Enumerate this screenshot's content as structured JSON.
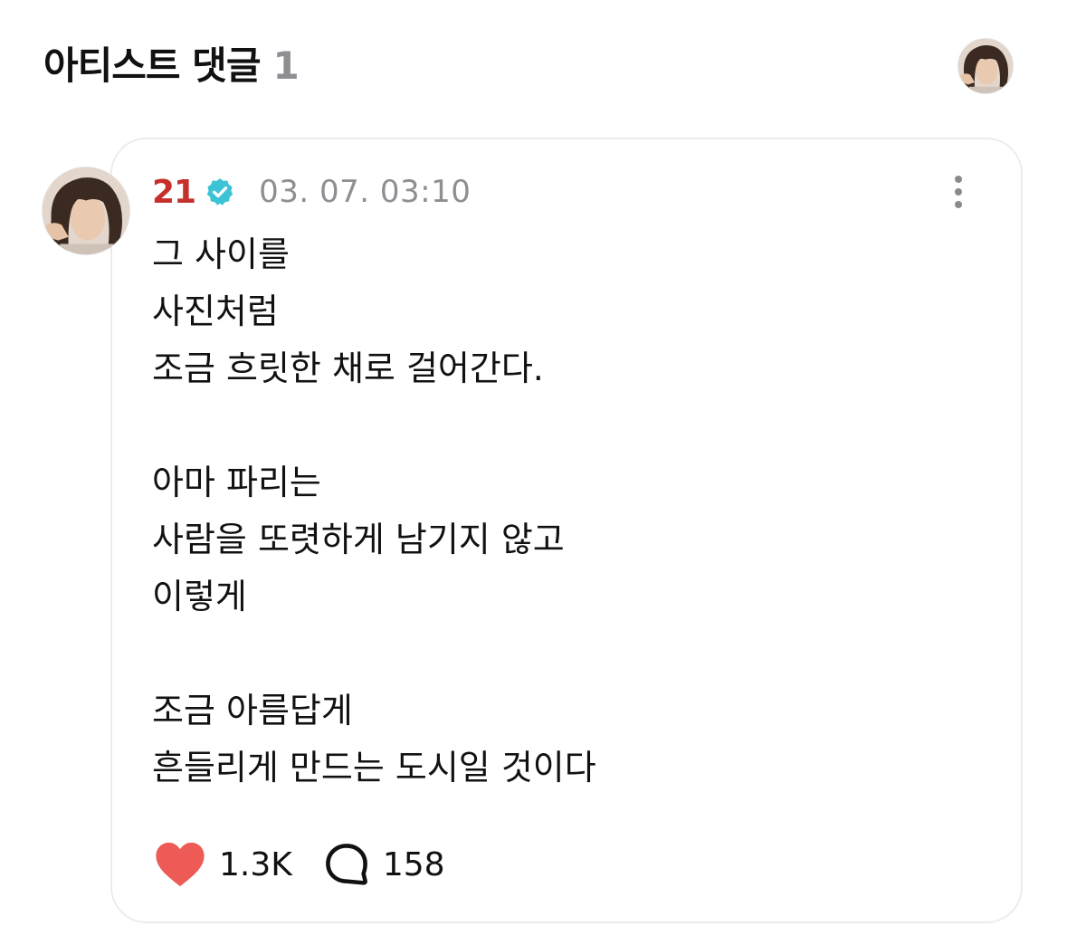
{
  "header": {
    "title": "아티스트 댓글",
    "count": "1"
  },
  "comment": {
    "author": "21",
    "timestamp": "03. 07. 03:10",
    "lines": [
      "그 사이를",
      "사진처럼",
      "조금 흐릿한 채로 걸어간다.",
      "",
      "아마 파리는",
      "사람을 또렷하게 남기지 않고",
      "이렇게",
      "",
      "조금 아름답게",
      "흔들리게 만드는 도시일 것이다"
    ],
    "likes": "1.3K",
    "replies": "158"
  },
  "colors": {
    "author": "#c5302b",
    "verified": "#3cc3d6",
    "heart": "#ee5a55",
    "muted": "#8e8e93",
    "card_border": "#ececee"
  },
  "icons": {
    "verified": "verified-badge-icon",
    "more": "more-vertical-icon",
    "like": "heart-icon",
    "reply": "speech-bubble-icon"
  }
}
